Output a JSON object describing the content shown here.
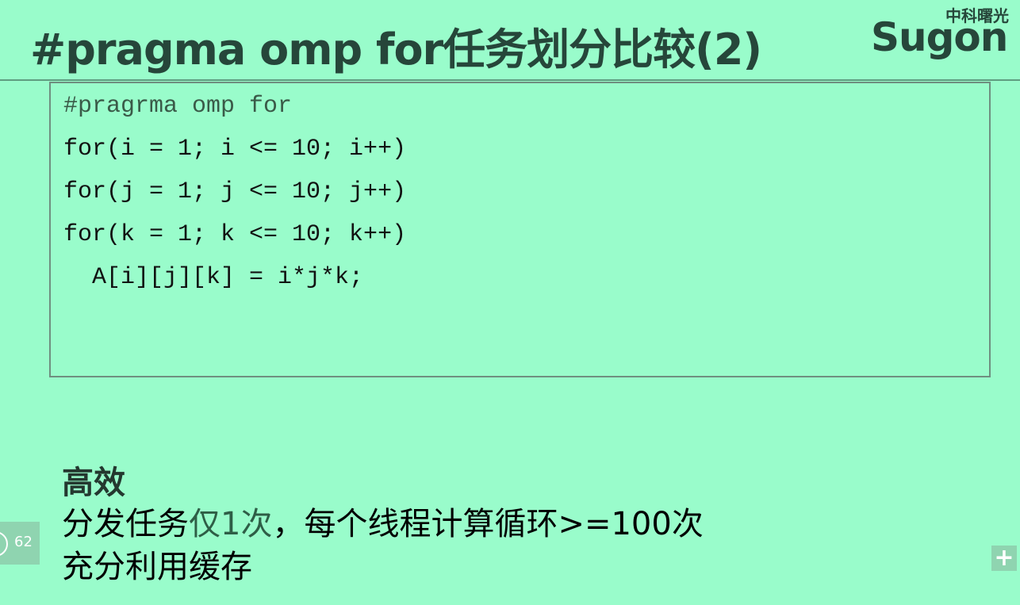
{
  "title": "#pragma omp for任务划分比较(2)",
  "logo": {
    "cn": "中科曙光",
    "en": "Sugon"
  },
  "code": [
    "#pragrma omp for",
    "for(i = 1; i <= 10; i++)",
    "for(j = 1; j <= 10; j++)",
    "for(k = 1; k <= 10; k++)",
    "  A[i][j][k] = i*j*k;"
  ],
  "bullets": {
    "heading": "高效",
    "line1a": "分发任务",
    "line1b": "仅1次",
    "line1c": "，每个线程计算循环>=100次",
    "line2": "充分利用缓存"
  },
  "page_number": "62",
  "plus_label": "+"
}
